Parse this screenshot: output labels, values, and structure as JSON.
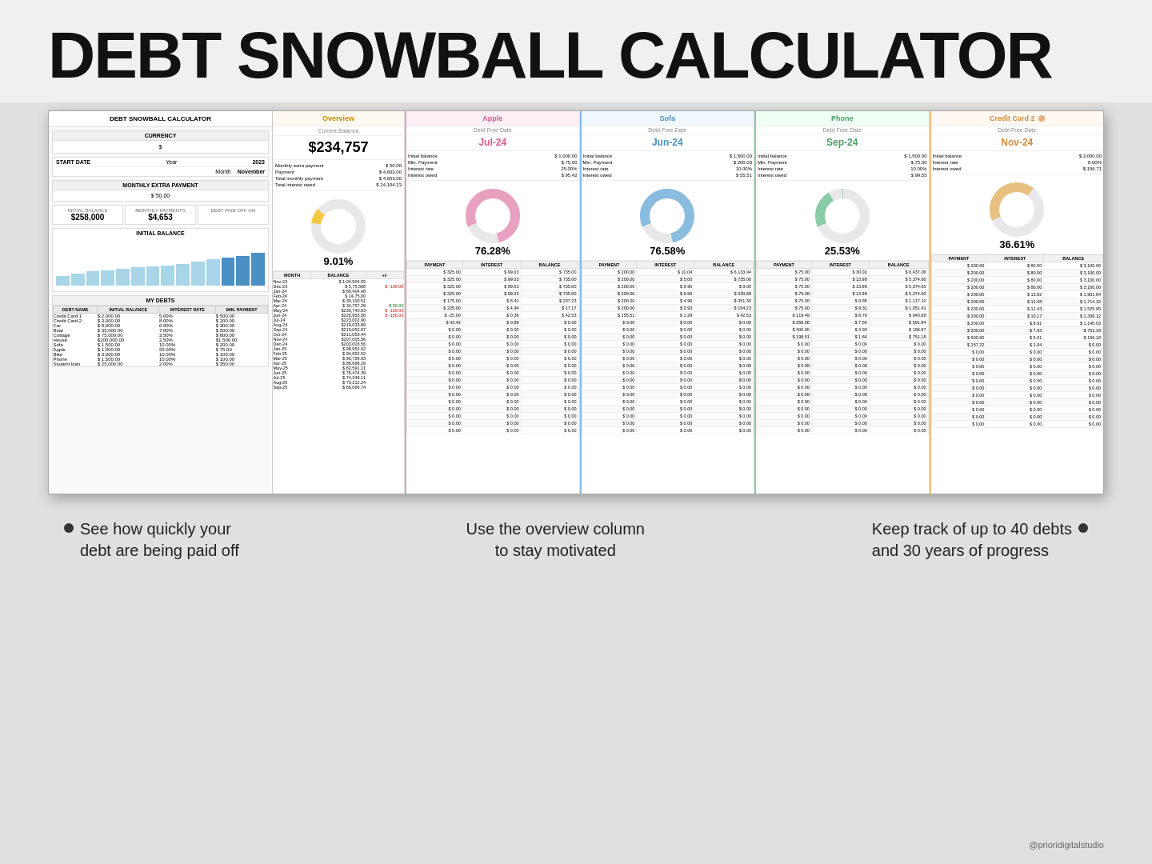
{
  "title": "DEBT SNOWBALL CALCULATOR",
  "header": {
    "title": "DEBT SNOWBALL CALCULATOR"
  },
  "left_panel": {
    "title": "DEBT SNOWBALL CALCULATOR",
    "currency_label": "CURRENCY",
    "currency_value": "$",
    "start_date_label": "START DATE",
    "year_label": "Year",
    "year_value": "2023",
    "month_label": "Month",
    "month_value": "November",
    "monthly_extra_label": "MONTHLY EXTRA PAYMENT",
    "monthly_extra_value": "$ 50.00",
    "chart_title": "INITIAL BALANCE",
    "initial_balance_label": "INITIAL BALANCE",
    "initial_balance_value": "$258,000",
    "monthly_payments_label": "MONTHLY PAYMENTS",
    "monthly_payments_value": "$4,653",
    "debt_paid_label": "DEBT PAID OFF ON",
    "my_debts_title": "MY DEBTS",
    "debts_columns": [
      "DEBT NAME",
      "INITIAL BALANCE",
      "INTEREST RATE",
      "MIN. PAYMENT"
    ],
    "debts": [
      {
        "name": "Credit Card 1",
        "balance": "$ 2,000.00",
        "rate": "5.00%",
        "payment": "$ 500.00"
      },
      {
        "name": "Credit Card 2",
        "balance": "$ 3,000.00",
        "rate": "8.00%",
        "payment": "$ 200.00"
      },
      {
        "name": "Car",
        "balance": "$ 8,000.00",
        "rate": "6.00%",
        "payment": "$ 300.00"
      },
      {
        "name": "Boat",
        "balance": "$ 35,000.00",
        "rate": "7.00%",
        "payment": "$ 500.00"
      },
      {
        "name": "Cottage",
        "balance": "$ 75,000.00",
        "rate": "3.50%",
        "payment": "$ 800.00"
      },
      {
        "name": "House",
        "balance": "$100,000.00",
        "rate": "2.50%",
        "payment": "$1,500.00"
      },
      {
        "name": "Sofa",
        "balance": "$ 1,500.00",
        "rate": "10.00%",
        "payment": "$ 200.00"
      },
      {
        "name": "Apple",
        "balance": "$ 1,000.00",
        "rate": "25.00%",
        "payment": "$ 75.00"
      },
      {
        "name": "Bike",
        "balance": "$ 3,000.00",
        "rate": "10.00%",
        "payment": "$ 103.00"
      },
      {
        "name": "Phone",
        "balance": "$ 1,500.00",
        "rate": "10.00%",
        "payment": "$ 100.00"
      },
      {
        "name": "Student loan",
        "balance": "$ 25,000.00",
        "rate": "2.00%",
        "payment": "$ 350.00"
      }
    ]
  },
  "overview": {
    "title": "Overview",
    "subheader": "Current Balance",
    "big_value": "$234,757",
    "date_label": "",
    "stats": [
      {
        "label": "Monthly extra payment",
        "value": "$ 50.00"
      },
      {
        "label": "Payment",
        "value": "$ 4,603.00"
      },
      {
        "label": "Total monthly payment",
        "value": "$ 4,653.00"
      },
      {
        "label": "Total interest owed",
        "value": "$ 24,104.23"
      }
    ],
    "donut_pct": "9.01%",
    "months": [
      "Nov-23",
      "Dec-23",
      "Jan-24",
      "Feb-24",
      "Mar-24",
      "Apr-24",
      "May-24",
      "Jun-24",
      "Jul-24",
      "Aug-24",
      "Sep-24",
      "Oct-24",
      "Nov-24",
      "Dec-24",
      "Jan-25",
      "Feb-25",
      "Mar-25",
      "Apr-25",
      "May-25",
      "Jun-25",
      "Jul-25",
      "Aug-25",
      "Sep-25"
    ],
    "table_columns": [
      "MONTH",
      "BALANCE",
      "+/-"
    ],
    "rows": [
      [
        "Nov-23",
        "$ 1,04,504.55",
        ""
      ],
      [
        "Dec-23",
        "$ 5,75,568",
        "$ -100.00"
      ],
      [
        "Jan-24",
        "$ 80,404.48",
        ""
      ],
      [
        "Feb-24",
        "$ 14,75,00",
        ""
      ],
      [
        "Mar-24",
        "$ 30,100.51",
        ""
      ],
      [
        "Apr-24",
        "$ 34,757.29",
        "$ 50.00"
      ],
      [
        "May-24",
        "$230,740.03",
        "$ -100.00"
      ],
      [
        "Jun-24",
        "$226,953.56",
        "$ -150.00"
      ],
      [
        "Jul-24",
        "$223,002.90",
        ""
      ],
      [
        "Aug-24",
        "$219,033.89",
        ""
      ],
      [
        "Sep-24",
        "$215,052.97",
        ""
      ],
      [
        "Oct-24",
        "$211,053.44",
        ""
      ],
      [
        "Nov-24",
        "$207,005.56",
        ""
      ],
      [
        "Dec-24",
        "$203,003.56",
        ""
      ],
      [
        "Jan-25",
        "$ 98,952.02",
        ""
      ],
      [
        "Feb-25",
        "$ 94,852.52",
        ""
      ],
      [
        "Mar-25",
        "$ 90,795.93",
        ""
      ],
      [
        "Apr-25",
        "$ 86,698.29",
        ""
      ],
      [
        "May-25",
        "$ 82,591.11",
        ""
      ],
      [
        "Jun-25",
        "$ 78,474.39",
        ""
      ],
      [
        "Jul-25",
        "$ 74,348.11",
        ""
      ],
      [
        "Aug-25",
        "$ 70,212.24",
        ""
      ],
      [
        "Sep-25",
        "$ 66,066.74",
        ""
      ]
    ]
  },
  "apple": {
    "title": "Apple",
    "subheader": "Debt Free Date",
    "date": "Jul-24",
    "stats": [
      {
        "label": "Initial balance",
        "value": "$ 1,000.00"
      },
      {
        "label": "Min. Payment",
        "value": "$ 75.00"
      },
      {
        "label": "Interest rate",
        "value": "25.00%"
      },
      {
        "label": "Interest owed",
        "value": "$ 95.42"
      }
    ],
    "donut_pct": "76.28%",
    "donut_color": "#e8a0c0",
    "table_columns": [
      "PAYMENT",
      "INTEREST",
      "BALANCE"
    ],
    "rows": [
      [
        "325.00",
        "99.03",
        "735.00"
      ],
      [
        "325.00",
        "99.03",
        "735.00"
      ],
      [
        "325.00",
        "99.03",
        "735.00"
      ],
      [
        "325.00",
        "99.03",
        "735.00"
      ],
      [
        "175.00",
        "8.41",
        "237.23"
      ],
      [
        "225.00",
        "4.94",
        "17.17"
      ],
      [
        "-25.00",
        "0.36",
        "42.53"
      ],
      [
        "43.42",
        "0.89",
        "0.00"
      ],
      [
        "0.00",
        "0.00",
        "0.00"
      ],
      [
        "0.00",
        "0.00",
        "0.00"
      ],
      [
        "0.00",
        "0.00",
        "0.00"
      ],
      [
        "0.00",
        "0.00",
        "0.00"
      ],
      [
        "0.00",
        "0.00",
        "0.00"
      ],
      [
        "0.00",
        "0.00",
        "0.00"
      ],
      [
        "0.00",
        "0.00",
        "0.00"
      ],
      [
        "0.00",
        "0.00",
        "0.00"
      ],
      [
        "0.00",
        "0.00",
        "0.00"
      ],
      [
        "0.00",
        "0.00",
        "0.00"
      ],
      [
        "0.00",
        "0.00",
        "0.00"
      ],
      [
        "0.00",
        "0.00",
        "0.00"
      ],
      [
        "0.00",
        "0.00",
        "0.00"
      ],
      [
        "0.00",
        "0.00",
        "0.00"
      ],
      [
        "0.00",
        "0.00",
        "0.00"
      ]
    ]
  },
  "sofa": {
    "title": "Sofa",
    "subheader": "Debt Free Date",
    "date": "Jun-24",
    "stats": [
      {
        "label": "Initial balance",
        "value": "$ 1,500.00"
      },
      {
        "label": "Min. Payment",
        "value": "$ 200.00"
      },
      {
        "label": "Interest rate",
        "value": "10.00%"
      },
      {
        "label": "Interest owed",
        "value": "$ 55.51"
      }
    ],
    "donut_pct": "76.58%",
    "donut_color": "#8abce0",
    "table_columns": [
      "PAYMENT",
      "INTEREST",
      "BALANCE"
    ],
    "rows": [
      [
        "200.00",
        "10.04",
        "6,133.44"
      ],
      [
        "200.00",
        "5.00",
        "735.00"
      ],
      [
        "200.00",
        "9.90",
        "9.00"
      ],
      [
        "200.00",
        "9.56",
        "530.88"
      ],
      [
        "200.00",
        "4.96",
        "351.30"
      ],
      [
        "200.00",
        "2.93",
        "154.23"
      ],
      [
        "155.51",
        "1.29",
        "42.53"
      ],
      [
        "0.00",
        "0.00",
        "0.00"
      ],
      [
        "0.00",
        "0.00",
        "0.00"
      ],
      [
        "0.00",
        "0.00",
        "0.00"
      ],
      [
        "0.00",
        "0.00",
        "0.00"
      ],
      [
        "0.00",
        "0.00",
        "0.00"
      ],
      [
        "0.00",
        "0.00",
        "0.00"
      ],
      [
        "0.00",
        "0.00",
        "0.00"
      ],
      [
        "0.00",
        "0.00",
        "0.00"
      ],
      [
        "0.00",
        "0.00",
        "0.00"
      ],
      [
        "0.00",
        "0.00",
        "0.00"
      ],
      [
        "0.00",
        "0.00",
        "0.00"
      ],
      [
        "0.00",
        "0.00",
        "0.00"
      ],
      [
        "0.00",
        "0.00",
        "0.00"
      ],
      [
        "0.00",
        "0.00",
        "0.00"
      ],
      [
        "0.00",
        "0.00",
        "0.00"
      ],
      [
        "0.00",
        "0.00",
        "0.00"
      ]
    ]
  },
  "phone": {
    "title": "Phone",
    "subheader": "Debt Free Date",
    "date": "Sep-24",
    "stats": [
      {
        "label": "Initial balance",
        "value": "$ 1,500.00"
      },
      {
        "label": "Min. Payment",
        "value": "$ 75.00"
      },
      {
        "label": "Interest rate",
        "value": "10.00%"
      },
      {
        "label": "Interest owed",
        "value": "$ 99.55"
      }
    ],
    "donut_pct": "25.53%",
    "donut_color": "#8acba8",
    "table_columns": [
      "PAYMENT",
      "INTEREST",
      "BALANCE"
    ],
    "rows": [
      [
        "75.00",
        "30.00",
        "6,437.06"
      ],
      [
        "75.00",
        "13.98",
        "5,374.60"
      ],
      [
        "75.00",
        "13.98",
        "5,374.60"
      ],
      [
        "75.00",
        "13.98",
        "5,374.60"
      ],
      [
        "75.00",
        "9.85",
        "1,117.10"
      ],
      [
        "75.00",
        "9.31",
        "1,051.41"
      ],
      [
        "119.49",
        "8.76",
        "940.68"
      ],
      [
        "356.58",
        "7.54",
        "591.94"
      ],
      [
        "400.00",
        "4.93",
        "196.87"
      ],
      [
        "198.51",
        "1.64",
        "751.18"
      ],
      [
        "0.00",
        "0.00",
        "0.00"
      ],
      [
        "0.00",
        "0.00",
        "0.00"
      ],
      [
        "0.00",
        "0.00",
        "0.00"
      ],
      [
        "0.00",
        "0.00",
        "0.00"
      ],
      [
        "0.00",
        "0.00",
        "0.00"
      ],
      [
        "0.00",
        "0.00",
        "0.00"
      ],
      [
        "0.00",
        "0.00",
        "0.00"
      ],
      [
        "0.00",
        "0.00",
        "0.00"
      ],
      [
        "0.00",
        "0.00",
        "0.00"
      ],
      [
        "0.00",
        "0.00",
        "0.00"
      ],
      [
        "0.00",
        "0.00",
        "0.00"
      ],
      [
        "0.00",
        "0.00",
        "0.00"
      ],
      [
        "0.00",
        "0.00",
        "0.00"
      ]
    ]
  },
  "cc2": {
    "title": "Credit Card 2",
    "subheader": "Debt Free Date",
    "date": "Nov-24",
    "stats": [
      {
        "label": "Initial balance",
        "value": "$ 3,000.00"
      },
      {
        "label": "Interest rate",
        "value": "8.00%"
      },
      {
        "label": "Interest owed",
        "value": "$ 156.71"
      }
    ],
    "donut_pct": "36.61%",
    "donut_color": "#e8c080",
    "table_columns": [
      "PAYMENT",
      "INTEREST",
      "BALANCE"
    ],
    "rows": [
      [
        "200.00",
        "80.00",
        "3,100.00"
      ],
      [
        "200.00",
        "80.00",
        "3,100.00"
      ],
      [
        "200.00",
        "80.00",
        "3,100.00"
      ],
      [
        "200.00",
        "80.00",
        "3,100.00"
      ],
      [
        "200.00",
        "13.92",
        "1,901.84"
      ],
      [
        "200.00",
        "12.48",
        "1,714.32"
      ],
      [
        "200.00",
        "11.43",
        "1,525.95"
      ],
      [
        "200.00",
        "10.17",
        "1,336.12"
      ],
      [
        "200.00",
        "8.91",
        "1,145.03"
      ],
      [
        "200.00",
        "7.63",
        "751.18"
      ],
      [
        "600.00",
        "5.01",
        "156.18"
      ],
      [
        "157.22",
        "1.04",
        "0.00"
      ],
      [
        "0.00",
        "0.00",
        "0.00"
      ],
      [
        "0.00",
        "0.00",
        "0.00"
      ],
      [
        "0.00",
        "0.00",
        "0.00"
      ],
      [
        "0.00",
        "0.00",
        "0.00"
      ],
      [
        "0.00",
        "0.00",
        "0.00"
      ],
      [
        "0.00",
        "0.00",
        "0.00"
      ],
      [
        "0.00",
        "0.00",
        "0.00"
      ],
      [
        "0.00",
        "0.00",
        "0.00"
      ],
      [
        "0.00",
        "0.00",
        "0.00"
      ],
      [
        "0.00",
        "0.00",
        "0.00"
      ],
      [
        "0.00",
        "0.00",
        "0.00"
      ]
    ]
  },
  "annotations": {
    "left": "See how quickly your\ndebt are being paid off",
    "middle": "Use the overview column\nto stay motivated",
    "right": "Keep track of up to 40 debts\nand 30 years of progress"
  },
  "watermark": "@prioridigitalstudio",
  "chart_bars": [
    20,
    25,
    30,
    32,
    35,
    38,
    40,
    42,
    45,
    50,
    55,
    58,
    60,
    62
  ]
}
